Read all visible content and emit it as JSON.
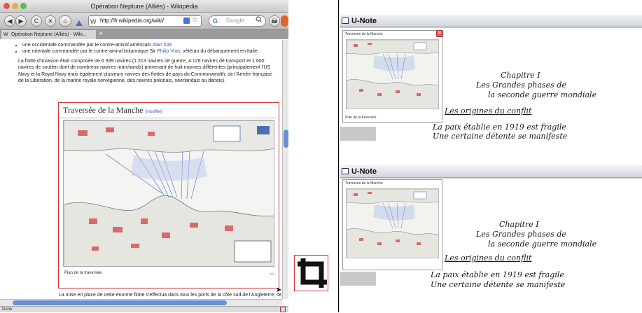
{
  "browser": {
    "window_title": "Opération Neptune (Alliés) - Wikipédia",
    "url": "http://fr.wikipedia.org/wiki/",
    "search_placeholder": "Google",
    "tab_label": "Opération Neptune (Alliés) - Wiki...",
    "tab_add": "+",
    "status": "Done",
    "nav": {
      "back": "◀",
      "forward": "▶",
      "reload": "C",
      "stop": "✕",
      "home": "⌂"
    }
  },
  "article": {
    "bullet1_pre": "une occidentale commandée par le contre-amiral américain ",
    "bullet1_link": "Alan Kirk",
    "bullet2_pre": "une orientale commandée par le contre-amiral britannique Sir ",
    "bullet2_link": "Philip Vian",
    "bullet2_post": ", vétéran du débarquement en Italie.",
    "para": "La flotte d'invasion était composée de 6 939 navires (1 213 navires de guerre, 4 126 navires de transport et 1 600 navires de soutien dont de nombreux navires marchands) provenant de huit marines différentes (principalement l'US Navy et la Royal Navy mais également plusieurs navires des flottes de pays du Commonwealth, de l'Armée française de la Libération, de la marine royale norvégienne, des navires polonais, néerlandais ou danois).",
    "section_title": "Traversée de la Manche",
    "section_edit": "[modifier]",
    "map_caption": "Plan de la traversée",
    "footer_line": "La mise en place de cette énorme flotte s'effectua dans tous les ports de la côte sud de l'Angleterre, de"
  },
  "unote": {
    "app_title": "U-Note",
    "thumb_title": "Traversée de la Manche",
    "thumb_caption": "Plan de la traversée",
    "close_glyph": "✕",
    "notes": {
      "line1": "Chapitre I",
      "line2": "Les Grandes phases de",
      "line3": "la seconde guerre mondiale",
      "line4": "Les origines du conflit",
      "line5": "La paix établie en 1919 est fragile",
      "line6": "Une certaine détente se manifeste"
    }
  },
  "colors": {
    "highlight_red": "#cc3333",
    "link_blue": "#3355cc",
    "scroll_blue": "#6c8ed6"
  },
  "icons": [
    "crop-icon",
    "window-icon",
    "close-icon",
    "search-icon",
    "bookmark-star-icon"
  ]
}
